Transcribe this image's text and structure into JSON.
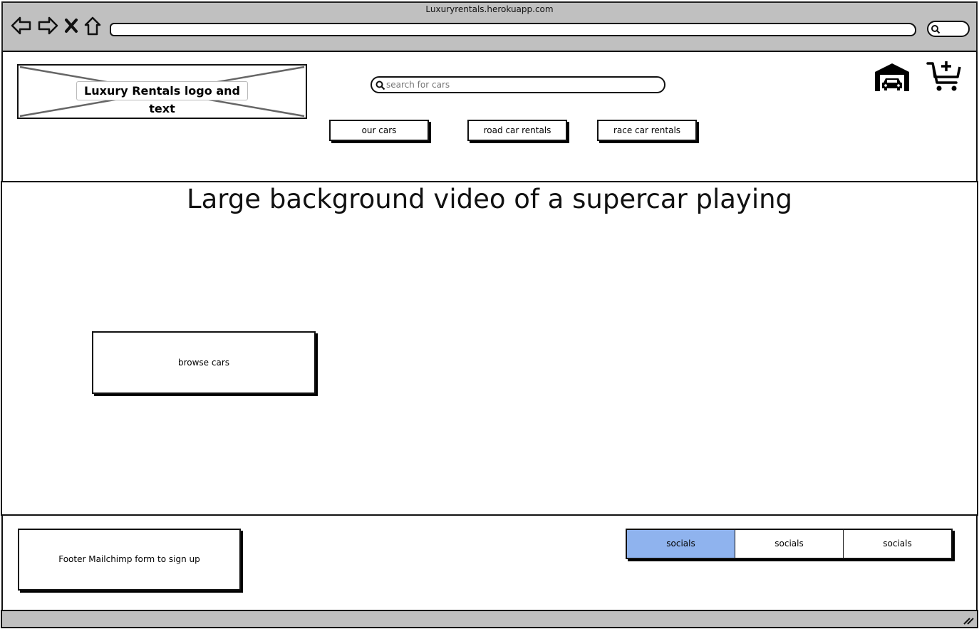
{
  "browser": {
    "title": "Luxuryrentals.herokuapp.com",
    "address_value": "",
    "icons": [
      "back-arrow-icon",
      "forward-arrow-icon",
      "close-x-icon",
      "home-icon",
      "search-icon"
    ]
  },
  "header": {
    "logo_label": "Luxury Rentals logo and text",
    "search": {
      "placeholder": "search for cars"
    },
    "nav": [
      {
        "label": "our cars"
      },
      {
        "label": "road car rentals"
      },
      {
        "label": "race car rentals"
      }
    ],
    "icons": [
      "garage-icon",
      "cart-add-icon"
    ]
  },
  "hero": {
    "title": "Large background video of a supercar playing",
    "browse_label": "browse cars"
  },
  "footer": {
    "mailchimp_label": "Footer Mailchimp form to sign up",
    "socials": [
      {
        "label": "socials",
        "active": true
      },
      {
        "label": "socials",
        "active": false
      },
      {
        "label": "socials",
        "active": false
      }
    ]
  },
  "colors": {
    "chrome": "#c0c0c0",
    "active_social": "#8fb3ee",
    "stroke": "#111111"
  }
}
